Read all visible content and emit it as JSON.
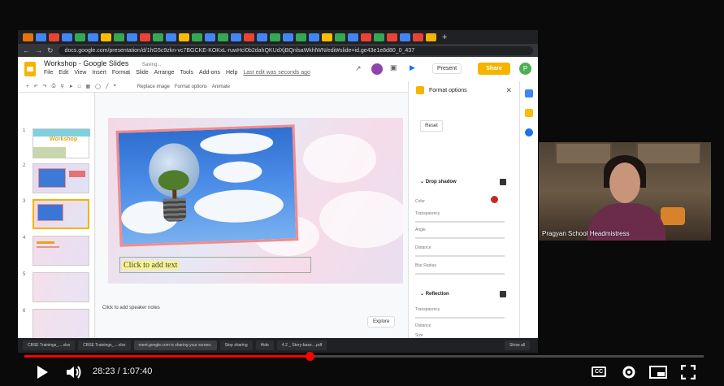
{
  "browser": {
    "url": "docs.google.com/presentation/d/1hG5c9zkn-vc7BGCKE-KOKxL-ruwHcl0b2dahQKUdXjBQnlsaWkhlWN/edit#slide=id.ge43e1e8d80_0_437",
    "tab_new": "+"
  },
  "app": {
    "doc_title": "Workshop - Google Slides",
    "saving": "Saving...",
    "menus": [
      "File",
      "Edit",
      "View",
      "Insert",
      "Format",
      "Slide",
      "Arrange",
      "Tools",
      "Add-ons",
      "Help"
    ],
    "last_edit": "Last edit was seconds ago",
    "present": "Present",
    "share": "Share",
    "avatar_initial": "P"
  },
  "toolbar": {
    "replace_image": "Replace image",
    "format_options": "Format options",
    "animate": "Animate"
  },
  "filmstrip": {
    "numbers": [
      "1",
      "2",
      "3",
      "4",
      "5",
      "6"
    ],
    "slide1_title": "Workshop"
  },
  "slide": {
    "placeholder": "Click to add text"
  },
  "speaker_notes": "Click to add speaker notes",
  "explore": "Explore",
  "format_panel": {
    "title": "Format options",
    "reset": "Reset",
    "drop_shadow": "Drop shadow",
    "color": "Color",
    "transparency": "Transparency",
    "angle": "Angle",
    "distance": "Distance",
    "blur_radius": "Blur Radius",
    "reflection": "Reflection",
    "r_transparency": "Transparency",
    "r_distance": "Distance",
    "r_size": "Size"
  },
  "taskbar": {
    "items": [
      "CBSE Trainings_....xlsx",
      "CBSE Trainings_....xlsx"
    ],
    "sharing": "meet.google.com is sharing your screen.",
    "stop_sharing": "Stop sharing",
    "hide": "Hide",
    "file3": "4.2 _ Story-base....pdf",
    "show_all": "Show all"
  },
  "webcam": {
    "name": "Pragyan School Headmistress"
  },
  "player": {
    "time": "28:23 / 1:07:40",
    "progress": 0.42,
    "cc": "CC"
  }
}
